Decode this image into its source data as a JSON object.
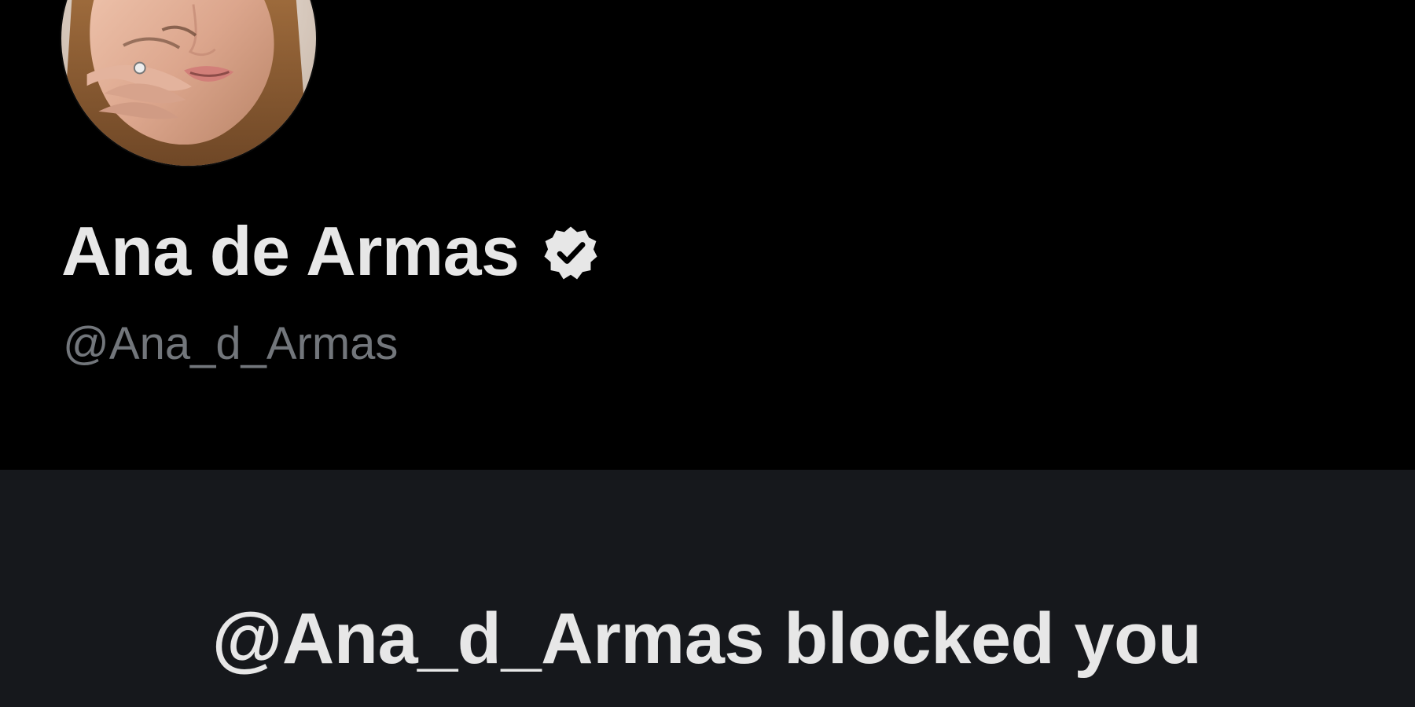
{
  "profile": {
    "display_name": "Ana de Armas",
    "handle": "@Ana_d_Armas",
    "verified": true,
    "avatar_icon": "profile-photo"
  },
  "blocked_notice": {
    "message": "@Ana_d_Armas blocked you"
  },
  "colors": {
    "background": "#000000",
    "panel": "#16181c",
    "primary_text": "#e7e7e7",
    "secondary_text": "#72767b"
  }
}
